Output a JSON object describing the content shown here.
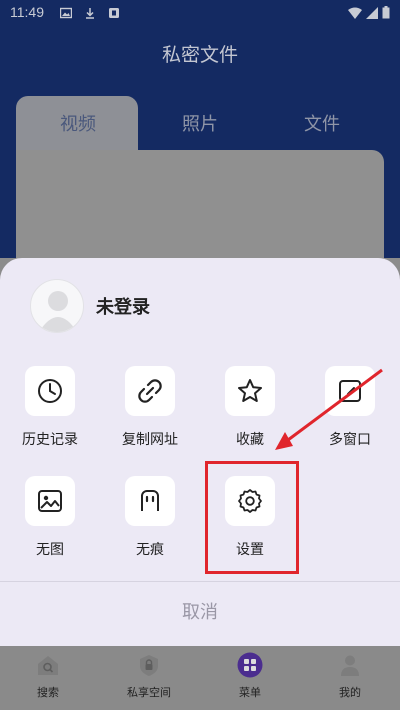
{
  "status_bar": {
    "time": "11:49"
  },
  "header": {
    "title": "私密文件"
  },
  "tabs": [
    {
      "label": "视频",
      "active": true
    },
    {
      "label": "照片",
      "active": false
    },
    {
      "label": "文件",
      "active": false
    }
  ],
  "sheet": {
    "user": {
      "name": "未登录"
    },
    "items": [
      {
        "label": "历史记录",
        "icon": "clock-icon"
      },
      {
        "label": "复制网址",
        "icon": "link-icon"
      },
      {
        "label": "收藏",
        "icon": "star-icon"
      },
      {
        "label": "多窗口",
        "icon": "window-icon"
      },
      {
        "label": "无图",
        "icon": "no-image-icon"
      },
      {
        "label": "无痕",
        "icon": "incognito-icon"
      },
      {
        "label": "设置",
        "icon": "gear-icon"
      }
    ],
    "cancel_label": "取消"
  },
  "bottom_nav": [
    {
      "label": "搜索",
      "icon": "home-search-icon"
    },
    {
      "label": "私享空间",
      "icon": "lock-icon"
    },
    {
      "label": "菜单",
      "icon": "menu-grid-icon",
      "active": true
    },
    {
      "label": "我的",
      "icon": "person-icon"
    }
  ],
  "colors": {
    "header_bg": "#142a62",
    "sheet_bg": "#ece9f5",
    "accent": "#6a3fd0",
    "annotation": "#e0252c"
  }
}
